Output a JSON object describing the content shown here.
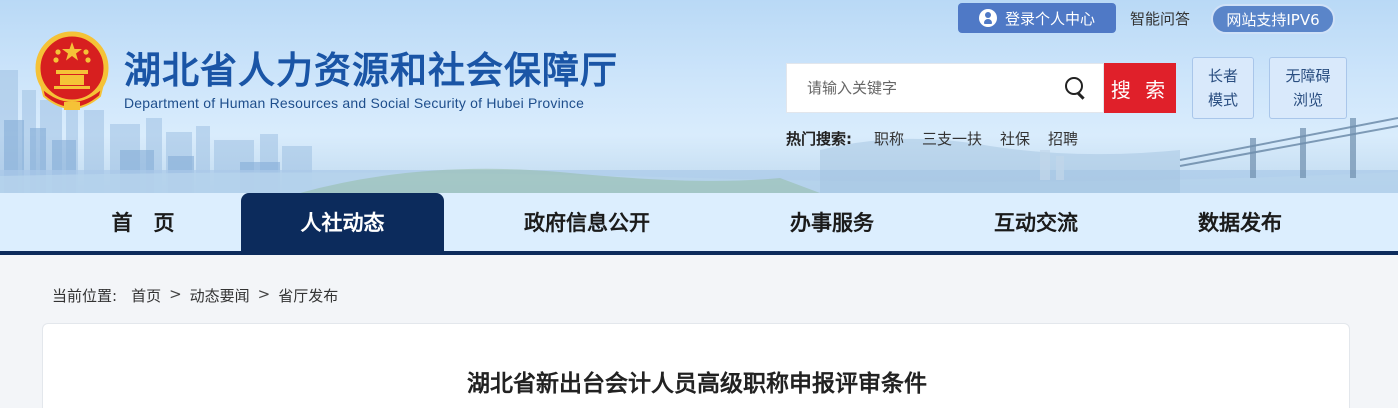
{
  "header": {
    "title": "湖北省人力资源和社会保障厅",
    "subtitle": "Department of Human Resources and Social Security of Hubei Province",
    "login_label": "登录个人中心",
    "qa_label": "智能问答",
    "ipv6_label": "网站支持IPV6",
    "search": {
      "placeholder": "请输入关键字",
      "button_label": "搜 索"
    },
    "hot_search": {
      "label": "热门搜索:",
      "items": [
        "职称",
        "三支一扶",
        "社保",
        "招聘"
      ]
    },
    "elder_mode": [
      "长者",
      "模式"
    ],
    "accessible": [
      "无障碍",
      "浏览"
    ]
  },
  "nav": {
    "items": [
      "首　页",
      "人社动态",
      "政府信息公开",
      "办事服务",
      "互动交流",
      "数据发布"
    ],
    "active_index": 1
  },
  "breadcrumb": {
    "label": "当前位置:",
    "items": [
      "首页",
      "动态要闻",
      "省厅发布"
    ],
    "separator": ">"
  },
  "article": {
    "title": "湖北省新出台会计人员高级职称申报评审条件"
  },
  "colors": {
    "primary_dark": "#0c2b5c",
    "title_blue": "#1a55a6",
    "search_red": "#e0202a",
    "login_blue": "#4f79c6"
  },
  "icons": [
    "national-emblem-icon",
    "user-icon",
    "search-icon"
  ]
}
